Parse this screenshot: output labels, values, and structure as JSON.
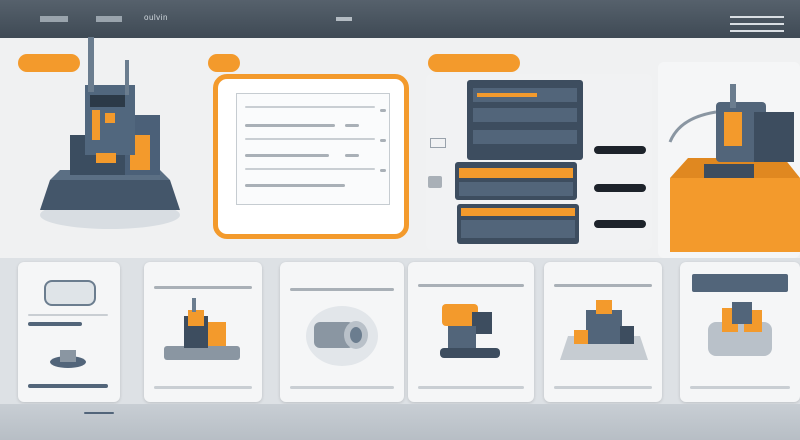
{
  "topbar": {
    "brand_a": "",
    "brand_b": "",
    "brand_c": "oulvin",
    "center": "",
    "menu_icon": "hamburger-icon"
  },
  "panel_pills": {
    "machine_panel": "",
    "search_panel": "",
    "cabinet_panel": "",
    "spindle_panel": ""
  },
  "icons": {
    "search": "search-icon",
    "machine": "cnc-machine-illustration",
    "cabinet": "tool-cabinet-illustration",
    "spindle": "spindle-unit-illustration",
    "product": "product-illustration"
  },
  "colors": {
    "accent": "#f39a2c",
    "header": "#4a5560",
    "steel": "#52657a",
    "panel": "#f5f6f7"
  }
}
